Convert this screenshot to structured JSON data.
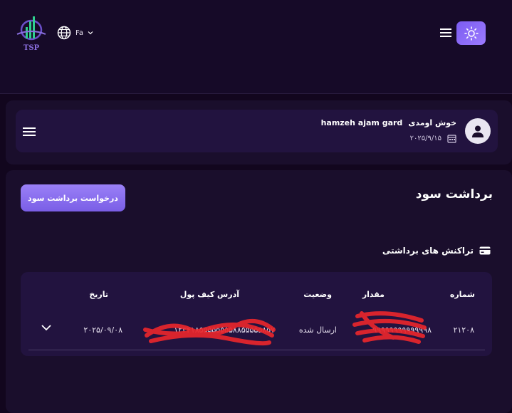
{
  "brand": {
    "logo_text": "TSP"
  },
  "header": {
    "language": "Fa"
  },
  "user": {
    "greeting": "خوش اومدی",
    "name": "hamzeh ajam gard",
    "date": "۲۰۲۵/۹/۱۵"
  },
  "page": {
    "title": "برداشت سود",
    "request_button": "درخواست برداشت سود",
    "section_title": "تراکنش های برداشتی"
  },
  "table": {
    "columns": [
      "شماره",
      "مقدار",
      "وضعیت",
      "آدرس کیف پول",
      "تاریخ"
    ],
    "rows": [
      {
        "number": "۲۱۲۰۸",
        "amount": "۹۹۹۹۹۹۹۹۹۹۹۹۹۸",
        "status": "ارسال شده",
        "wallet": "۱۲۳۴۱۸۵۵۵۵۵۵۵۵۸۸۵۵۵۵۵۸۵۷",
        "date": "۲۰۲۵/۰۹/۰۸"
      }
    ]
  },
  "colors": {
    "accent": "#8b6cf5",
    "background": "#12061e",
    "card": "#22133f",
    "redaction": "#e8262b"
  },
  "icons": [
    "globe-icon",
    "chevron-down-icon",
    "menu-icon",
    "sun-icon",
    "user-icon",
    "calendar-icon",
    "card-icon",
    "chevron-down-icon"
  ]
}
